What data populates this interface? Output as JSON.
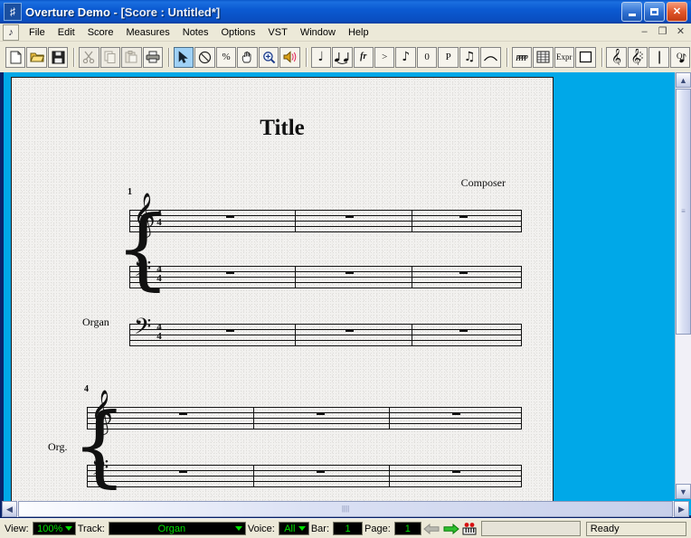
{
  "window": {
    "app_icon": "music-note-icon",
    "title_app": "Overture Demo",
    "title_doc": " - [Score : Untitled*]",
    "buttons": {
      "minimize": "minimize-button",
      "maximize": "maximize-button",
      "close": "✕"
    }
  },
  "menubar": {
    "doc_icon": "document-score-icon",
    "items": [
      "File",
      "Edit",
      "Score",
      "Measures",
      "Notes",
      "Options",
      "VST",
      "Window",
      "Help"
    ],
    "mdi_buttons": [
      "–",
      "❐",
      "✕"
    ]
  },
  "toolbar": {
    "groups": [
      [
        {
          "name": "new-document-button",
          "glyph": "🗋",
          "kind": "doc"
        },
        {
          "name": "open-folder-button",
          "glyph": "📂",
          "kind": "folder"
        },
        {
          "name": "save-button",
          "glyph": "💾",
          "kind": "save"
        }
      ],
      [
        {
          "name": "cut-button",
          "glyph": "✂",
          "kind": "cut",
          "disabled": true
        },
        {
          "name": "copy-button",
          "glyph": "⧉",
          "kind": "copy",
          "disabled": true
        },
        {
          "name": "paste-button",
          "glyph": "📋",
          "kind": "paste",
          "disabled": true
        },
        {
          "name": "print-button",
          "glyph": "🖨",
          "kind": "print"
        }
      ],
      [
        {
          "name": "select-arrow-tool",
          "glyph": "➤",
          "kind": "arrow",
          "selected": true
        },
        {
          "name": "erase-tool",
          "glyph": "⊗",
          "kind": "circlex"
        },
        {
          "name": "percent-tool",
          "glyph": "%",
          "kind": "text"
        },
        {
          "name": "hand-tool",
          "glyph": "✋",
          "kind": "hand"
        },
        {
          "name": "zoom-tool",
          "glyph": "🔍",
          "kind": "magnifier"
        },
        {
          "name": "speaker-tool",
          "glyph": "🔊",
          "kind": "speaker"
        }
      ],
      [
        {
          "name": "note-duration-tool",
          "glyph": "♩",
          "kind": "mus"
        },
        {
          "name": "tie-tool",
          "glyph": "♩♩",
          "kind": "tie"
        },
        {
          "name": "trill-tool",
          "glyph": "fr",
          "kind": "ital"
        },
        {
          "name": "accent-tool",
          "glyph": ">",
          "kind": "text"
        },
        {
          "name": "grace-note-tool",
          "glyph": "♪",
          "kind": "mus"
        },
        {
          "name": "fingering-tool",
          "glyph": "0",
          "kind": "text"
        },
        {
          "name": "pedal-tool",
          "glyph": "P",
          "kind": "text"
        },
        {
          "name": "beam-tool",
          "glyph": "♫",
          "kind": "mus"
        },
        {
          "name": "slur-tool",
          "glyph": "⁀",
          "kind": "slur"
        }
      ],
      [
        {
          "name": "dynamics-tool",
          "glyph": "pppp",
          "kind": "dyn"
        },
        {
          "name": "staff-sheet-tool",
          "glyph": "☷",
          "kind": "grid"
        },
        {
          "name": "expression-tool",
          "glyph": "Expr",
          "kind": "text-sm"
        },
        {
          "name": "box-tool",
          "glyph": "□",
          "kind": "box"
        }
      ],
      [
        {
          "name": "treble-clef-tool",
          "glyph": "𝄞",
          "kind": "clef"
        },
        {
          "name": "clef-dotted-tool",
          "glyph": "𝄞",
          "kind": "clefdot"
        },
        {
          "name": "barline-tool",
          "glyph": "|",
          "kind": "bar"
        },
        {
          "name": "quantize-note-tool",
          "glyph": "Q♪",
          "kind": "qnote"
        }
      ]
    ]
  },
  "score": {
    "title": "Title",
    "composer": "Composer",
    "systems": [
      {
        "measure_number": "1",
        "instrument_label": "Organ",
        "time_signature": {
          "top": "4",
          "bottom": "4"
        },
        "staves": [
          {
            "clef": "treble",
            "rests": 3
          },
          {
            "clef": "bass",
            "rests": 3
          },
          {
            "clef": "bass",
            "rests": 3
          }
        ]
      },
      {
        "measure_number": "4",
        "instrument_label": "Org.",
        "time_signature": null,
        "staves": [
          {
            "clef": "treble",
            "rests": 3
          },
          {
            "clef": "bass",
            "rests": 3
          }
        ]
      }
    ]
  },
  "statusbar": {
    "view_label": "View:",
    "view_value": "100%",
    "track_label": "Track:",
    "track_value": "Organ",
    "voice_label": "Voice:",
    "voice_value": "All",
    "bar_label": "Bar:",
    "bar_value": "1",
    "page_label": "Page:",
    "page_value": "1",
    "prev_page_icon": "arrow-left-icon",
    "next_page_icon": "arrow-right-icon",
    "keys_icon": "piano-keys-icon",
    "message": "Ready"
  },
  "colors": {
    "mdi_background": "#00a8e8",
    "titlebar_blue": "#0b5ad2",
    "lcd_green": "#00e000",
    "toolbar_face": "#ece9d8"
  }
}
